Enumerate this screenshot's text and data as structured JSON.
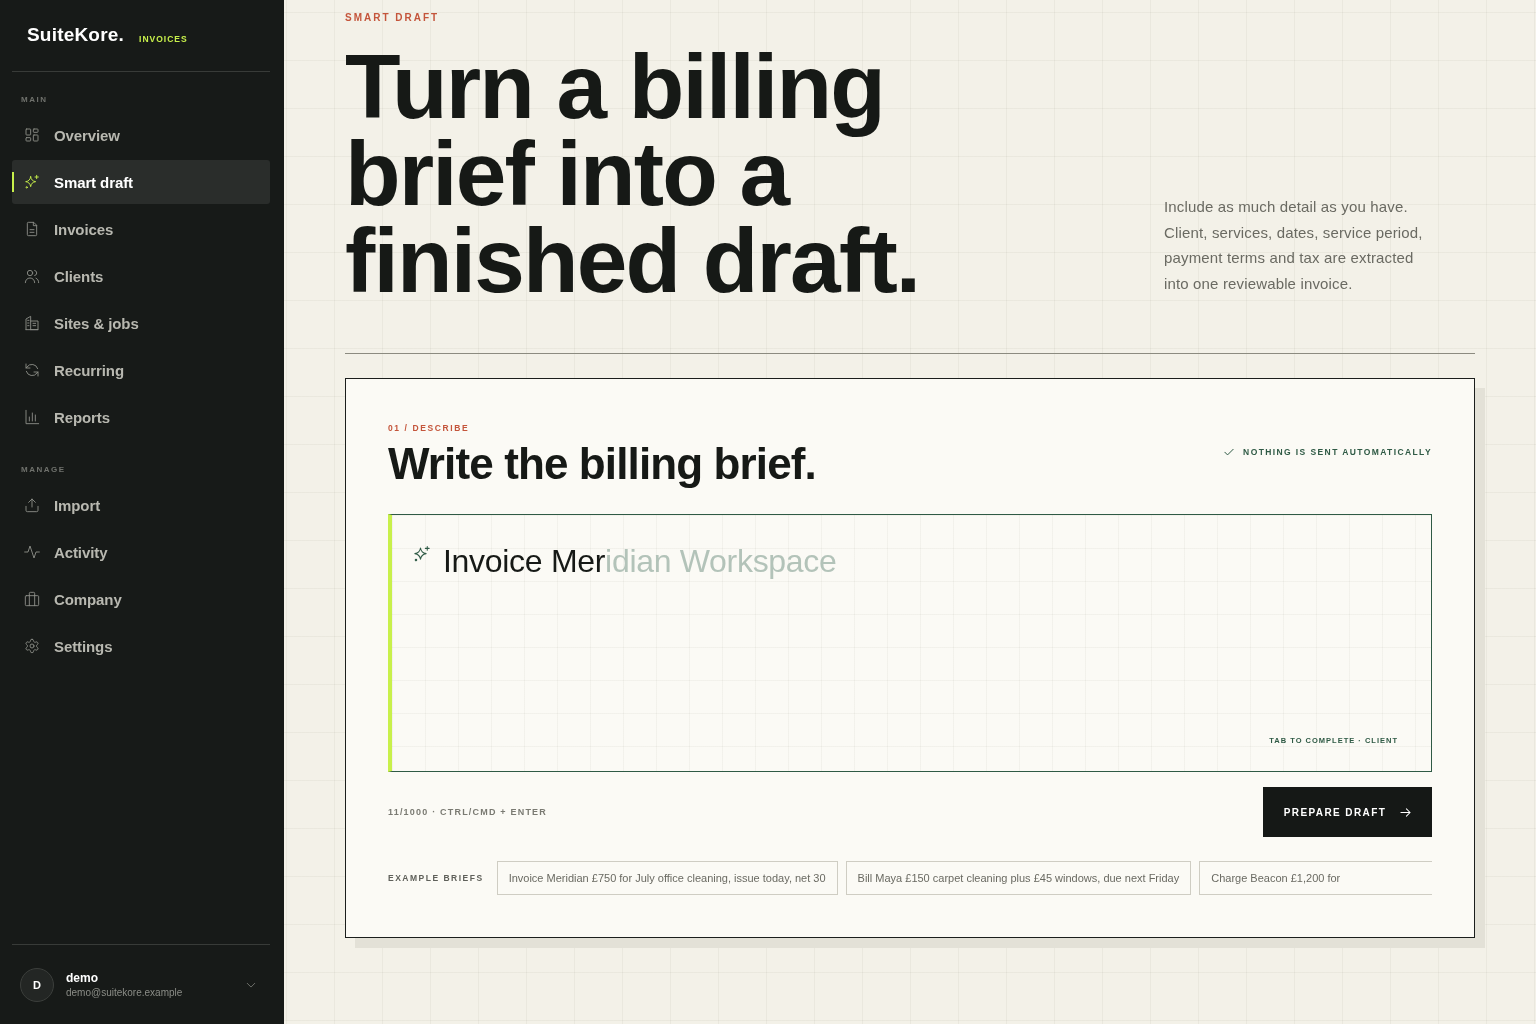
{
  "sidebar": {
    "brand": "SuiteKore.",
    "product": "INVOICES",
    "sections": [
      {
        "title": "MAIN",
        "items": [
          {
            "label": "Overview",
            "selected": false
          },
          {
            "label": "Smart draft",
            "selected": true
          },
          {
            "label": "Invoices",
            "selected": false
          },
          {
            "label": "Clients",
            "selected": false
          },
          {
            "label": "Sites & jobs",
            "selected": false
          },
          {
            "label": "Recurring",
            "selected": false
          },
          {
            "label": "Reports",
            "selected": false
          }
        ]
      },
      {
        "title": "MANAGE",
        "items": [
          {
            "label": "Import",
            "selected": false
          },
          {
            "label": "Activity",
            "selected": false
          },
          {
            "label": "Company",
            "selected": false
          },
          {
            "label": "Settings",
            "selected": false
          }
        ]
      }
    ],
    "user": {
      "initial": "D",
      "name": "demo",
      "email": "demo@suitekore.example"
    }
  },
  "header": {
    "eyebrow": "SMART DRAFT",
    "title": "Turn a billing brief into a finished draft.",
    "description": "Include as much detail as you have. Client, services, dates, service period, payment terms and tax are extracted into one reviewable invoice."
  },
  "composer": {
    "step": "01 / DESCRIBE",
    "title": "Write the billing brief.",
    "note": "NOTHING IS SENT AUTOMATICALLY",
    "brief": {
      "value": "Invoice Mer",
      "suggestion": "idian Workspace",
      "hint": "TAB TO COMPLETE · CLIENT"
    },
    "counter": "11/1000 · CTRL/CMD + ENTER",
    "submit": "PREPARE DRAFT",
    "examples_label": "EXAMPLE BRIEFS",
    "examples": [
      "Invoice Meridian £750 for July office cleaning, issue today, net 30",
      "Bill Maya £150 carpet cleaning plus £45 windows, due next Friday",
      "Charge Beacon £1,200 for"
    ]
  }
}
